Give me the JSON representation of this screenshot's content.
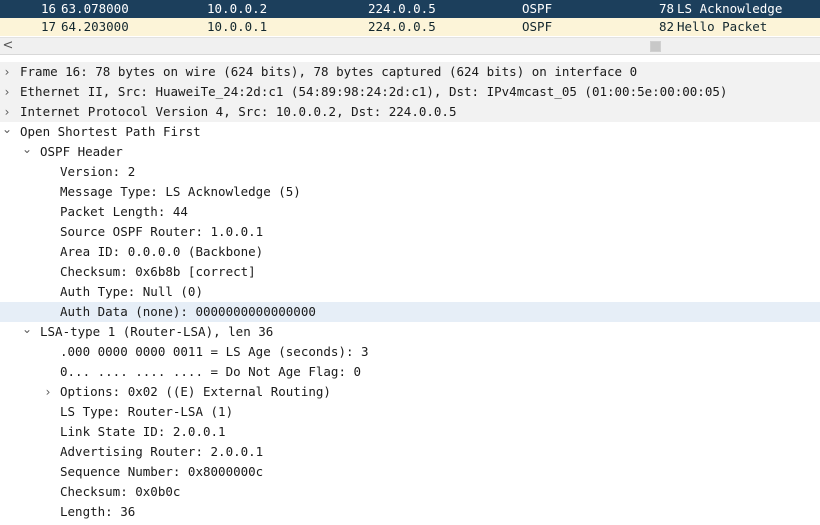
{
  "packets": [
    {
      "no": "16",
      "time": "63.078000",
      "source": "10.0.0.2",
      "destination": "224.0.0.5",
      "protocol": "OSPF",
      "length": "78",
      "info": "LS Acknowledge"
    },
    {
      "no": "17",
      "time": "64.203000",
      "source": "10.0.0.1",
      "destination": "224.0.0.5",
      "protocol": "OSPF",
      "length": "82",
      "info": "Hello Packet"
    }
  ],
  "scrollbar": {
    "left_arrow": "<"
  },
  "colors": {
    "selected_row": "#1c3f5c",
    "ospf_row": "#fcf4d8",
    "highlight_row": "#e6eef7"
  },
  "details": [
    {
      "level": 0,
      "toggle": "collapsed",
      "text": "Frame 16: 78 bytes on wire (624 bits), 78 bytes captured (624 bits) on interface 0"
    },
    {
      "level": 0,
      "toggle": "collapsed",
      "text": "Ethernet II, Src: HuaweiTe_24:2d:c1 (54:89:98:24:2d:c1), Dst: IPv4mcast_05 (01:00:5e:00:00:05)"
    },
    {
      "level": 0,
      "toggle": "collapsed",
      "text": "Internet Protocol Version 4, Src: 10.0.0.2, Dst: 224.0.0.5"
    },
    {
      "level": 0,
      "toggle": "expanded",
      "text": "Open Shortest Path First"
    },
    {
      "level": 1,
      "toggle": "expanded",
      "text": "OSPF Header"
    },
    {
      "level": 2,
      "toggle": "none",
      "text": "Version: 2"
    },
    {
      "level": 2,
      "toggle": "none",
      "text": "Message Type: LS Acknowledge (5)"
    },
    {
      "level": 2,
      "toggle": "none",
      "text": "Packet Length: 44"
    },
    {
      "level": 2,
      "toggle": "none",
      "text": "Source OSPF Router: 1.0.0.1"
    },
    {
      "level": 2,
      "toggle": "none",
      "text": "Area ID: 0.0.0.0 (Backbone)"
    },
    {
      "level": 2,
      "toggle": "none",
      "text": "Checksum: 0x6b8b [correct]"
    },
    {
      "level": 2,
      "toggle": "none",
      "text": "Auth Type: Null (0)"
    },
    {
      "level": 2,
      "toggle": "none",
      "text": "Auth Data (none): 0000000000000000",
      "highlighted": true
    },
    {
      "level": 1,
      "toggle": "expanded",
      "text": "LSA-type 1 (Router-LSA), len 36"
    },
    {
      "level": 2,
      "toggle": "none",
      "text": ".000 0000 0000 0011 = LS Age (seconds): 3"
    },
    {
      "level": 2,
      "toggle": "none",
      "text": "0... .... .... .... = Do Not Age Flag: 0"
    },
    {
      "level": 2,
      "toggle": "collapsed",
      "text": "Options: 0x02 ((E) External Routing)"
    },
    {
      "level": 2,
      "toggle": "none",
      "text": "LS Type: Router-LSA (1)"
    },
    {
      "level": 2,
      "toggle": "none",
      "text": "Link State ID: 2.0.0.1"
    },
    {
      "level": 2,
      "toggle": "none",
      "text": "Advertising Router: 2.0.0.1"
    },
    {
      "level": 2,
      "toggle": "none",
      "text": "Sequence Number: 0x8000000c"
    },
    {
      "level": 2,
      "toggle": "none",
      "text": "Checksum: 0x0b0c"
    },
    {
      "level": 2,
      "toggle": "none",
      "text": "Length: 36"
    }
  ]
}
